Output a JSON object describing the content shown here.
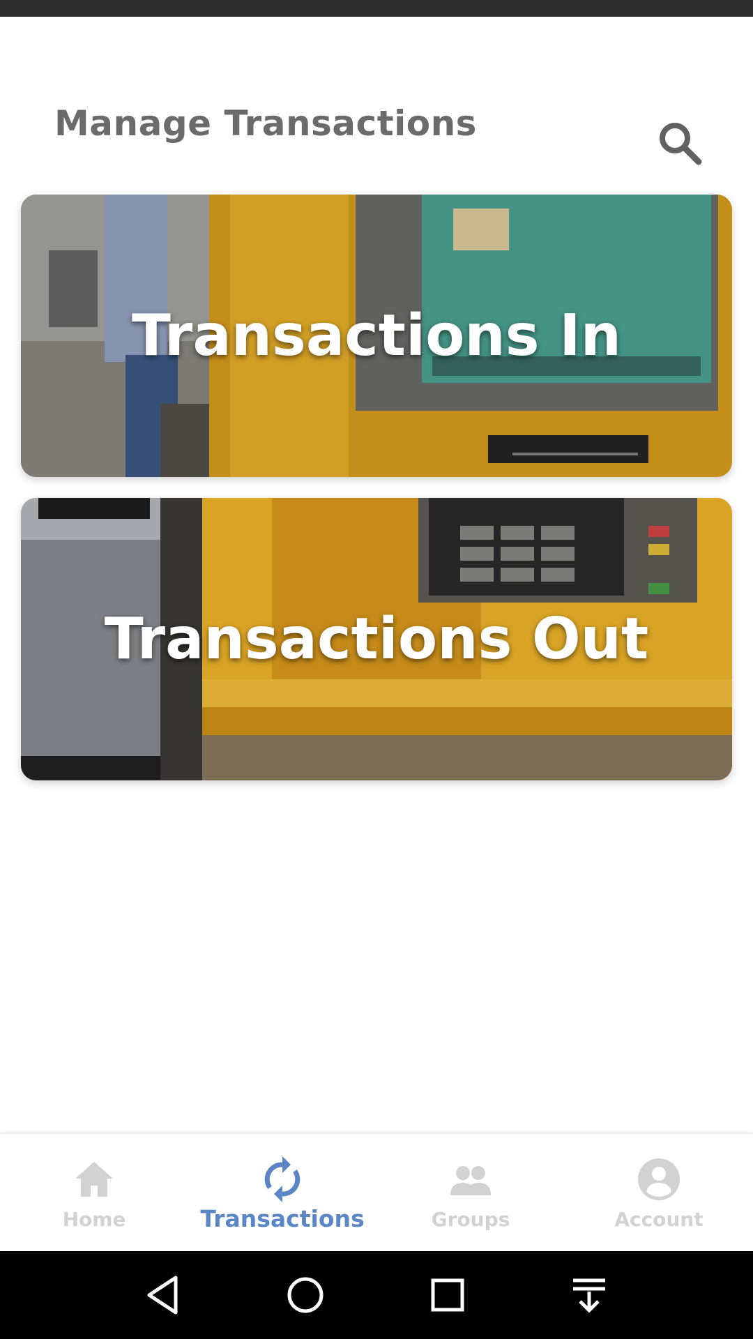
{
  "header": {
    "title": "Manage Transactions",
    "search_icon": "search-icon"
  },
  "cards": {
    "in": {
      "label": "Transactions In"
    },
    "out": {
      "label": "Transactions Out"
    }
  },
  "bottom_nav": {
    "active": "Transactions",
    "active_color": "#5b86c5",
    "inactive_color": "#d2d2d2",
    "items": [
      {
        "label": "Home",
        "icon": "home-icon"
      },
      {
        "label": "Transactions",
        "icon": "sync-icon"
      },
      {
        "label": "Groups",
        "icon": "group-icon"
      },
      {
        "label": "Account",
        "icon": "account-circle-icon"
      }
    ]
  },
  "system_nav": {
    "icons": [
      "back-icon",
      "home-circle-icon",
      "recents-icon",
      "notification-pull-icon"
    ]
  }
}
